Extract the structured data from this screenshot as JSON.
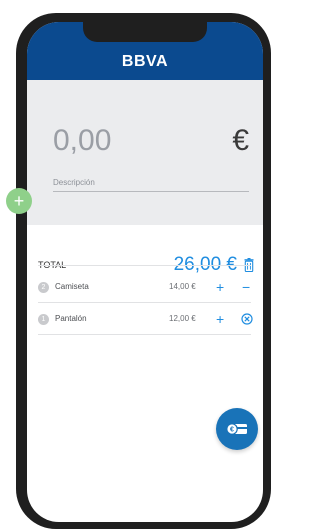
{
  "header": {
    "brand": "BBVA"
  },
  "amount": {
    "value": "0,00",
    "currency": "€"
  },
  "description": {
    "placeholder": "Descripción"
  },
  "add_button": {
    "label": "+"
  },
  "total": {
    "label": "TOTAL",
    "value": "26,00 €"
  },
  "items": [
    {
      "qty": "2",
      "name": "Camiseta",
      "price": "14,00 €",
      "plus": "+",
      "minus": "−"
    },
    {
      "qty": "1",
      "name": "Pantalón",
      "price": "12,00 €",
      "plus": "+"
    }
  ],
  "icons": {
    "trash": "trash-icon",
    "remove": "remove-circle-icon",
    "fab": "payment-card-icon"
  },
  "colors": {
    "header": "#0b4a8f",
    "accent": "#1f8de0",
    "add_button": "#8fd08a",
    "fab": "#1973b8"
  }
}
